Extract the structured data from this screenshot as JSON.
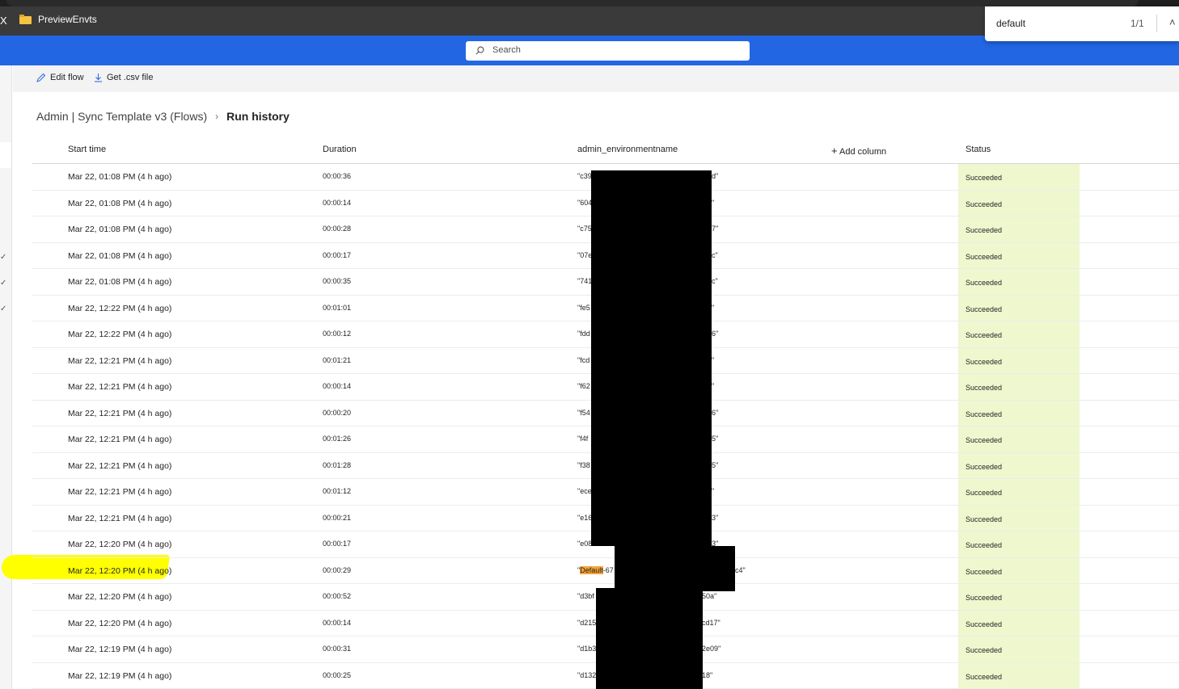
{
  "browser": {
    "bookmark_close": "X",
    "bookmark_folder": "PreviewEnvts"
  },
  "findbar": {
    "query": "default",
    "count": "1/1"
  },
  "appbar": {
    "search_placeholder": "Search"
  },
  "commands": {
    "edit_flow": "Edit flow",
    "get_csv": "Get .csv file"
  },
  "breadcrumb": {
    "parent": "Admin | Sync Template v3 (Flows)",
    "current": "Run history"
  },
  "table": {
    "headers": {
      "start_time": "Start time",
      "duration": "Duration",
      "env": "admin_environmentname",
      "add_column": "Add column",
      "status": "Status"
    },
    "rows": [
      {
        "start": "Mar 22, 01:08 PM (4 h ago)",
        "duration": "00:00:36",
        "env_prefix": "\"c39",
        "env_suffix": "d\"",
        "status": "Succeeded"
      },
      {
        "start": "Mar 22, 01:08 PM (4 h ago)",
        "duration": "00:00:14",
        "env_prefix": "\"604",
        "env_suffix": "\"",
        "status": "Succeeded"
      },
      {
        "start": "Mar 22, 01:08 PM (4 h ago)",
        "duration": "00:00:28",
        "env_prefix": "\"c75",
        "env_suffix": "7\"",
        "status": "Succeeded"
      },
      {
        "start": "Mar 22, 01:08 PM (4 h ago)",
        "duration": "00:00:17",
        "env_prefix": "\"07e",
        "env_suffix": "c\"",
        "status": "Succeeded"
      },
      {
        "start": "Mar 22, 01:08 PM (4 h ago)",
        "duration": "00:00:35",
        "env_prefix": "\"741",
        "env_suffix": "c\"",
        "status": "Succeeded"
      },
      {
        "start": "Mar 22, 12:22 PM (4 h ago)",
        "duration": "00:01:01",
        "env_prefix": "\"fe5",
        "env_suffix": "\"",
        "status": "Succeeded"
      },
      {
        "start": "Mar 22, 12:22 PM (4 h ago)",
        "duration": "00:00:12",
        "env_prefix": "\"fdd",
        "env_suffix": "6\"",
        "status": "Succeeded"
      },
      {
        "start": "Mar 22, 12:21 PM (4 h ago)",
        "duration": "00:01:21",
        "env_prefix": "\"fcd",
        "env_suffix": "\"",
        "status": "Succeeded"
      },
      {
        "start": "Mar 22, 12:21 PM (4 h ago)",
        "duration": "00:00:14",
        "env_prefix": "\"f62",
        "env_suffix": "\"",
        "status": "Succeeded"
      },
      {
        "start": "Mar 22, 12:21 PM (4 h ago)",
        "duration": "00:00:20",
        "env_prefix": "\"f54",
        "env_suffix": "6\"",
        "status": "Succeeded"
      },
      {
        "start": "Mar 22, 12:21 PM (4 h ago)",
        "duration": "00:01:26",
        "env_prefix": "\"f4f",
        "env_suffix": "5\"",
        "status": "Succeeded"
      },
      {
        "start": "Mar 22, 12:21 PM (4 h ago)",
        "duration": "00:01:28",
        "env_prefix": "\"f38",
        "env_suffix": "5\"",
        "status": "Succeeded"
      },
      {
        "start": "Mar 22, 12:21 PM (4 h ago)",
        "duration": "00:01:12",
        "env_prefix": "\"ece",
        "env_suffix": "\"",
        "status": "Succeeded"
      },
      {
        "start": "Mar 22, 12:21 PM (4 h ago)",
        "duration": "00:00:21",
        "env_prefix": "\"e16",
        "env_suffix": "3\"",
        "status": "Succeeded"
      },
      {
        "start": "Mar 22, 12:20 PM (4 h ago)",
        "duration": "00:00:17",
        "env_prefix": "\"e08",
        "env_suffix": "3\"",
        "status": "Succeeded"
      },
      {
        "start": "Mar 22, 12:20 PM (4 h ago)",
        "duration": "00:00:29",
        "env_prefix": "\"",
        "env_match": "Default",
        "env_prefix2": "-67",
        "env_suffix": "c4\"",
        "status": "Succeeded"
      },
      {
        "start": "Mar 22, 12:20 PM (4 h ago)",
        "duration": "00:00:52",
        "env_prefix": "\"d3bf",
        "env_suffix": "50a\"",
        "status": "Succeeded"
      },
      {
        "start": "Mar 22, 12:20 PM (4 h ago)",
        "duration": "00:00:14",
        "env_prefix": "\"d215",
        "env_suffix": "cd17\"",
        "status": "Succeeded"
      },
      {
        "start": "Mar 22, 12:19 PM (4 h ago)",
        "duration": "00:00:31",
        "env_prefix": "\"d1b3",
        "env_suffix": "2e09\"",
        "status": "Succeeded"
      },
      {
        "start": "Mar 22, 12:19 PM (4 h ago)",
        "duration": "00:00:25",
        "env_prefix": "\"d132",
        "env_suffix": "18\"",
        "status": "Succeeded"
      }
    ]
  },
  "colors": {
    "appbar": "#2266e3",
    "status_bg": "#eef7ce",
    "highlight": "#ffff00",
    "find_match": "#f5a43a"
  }
}
